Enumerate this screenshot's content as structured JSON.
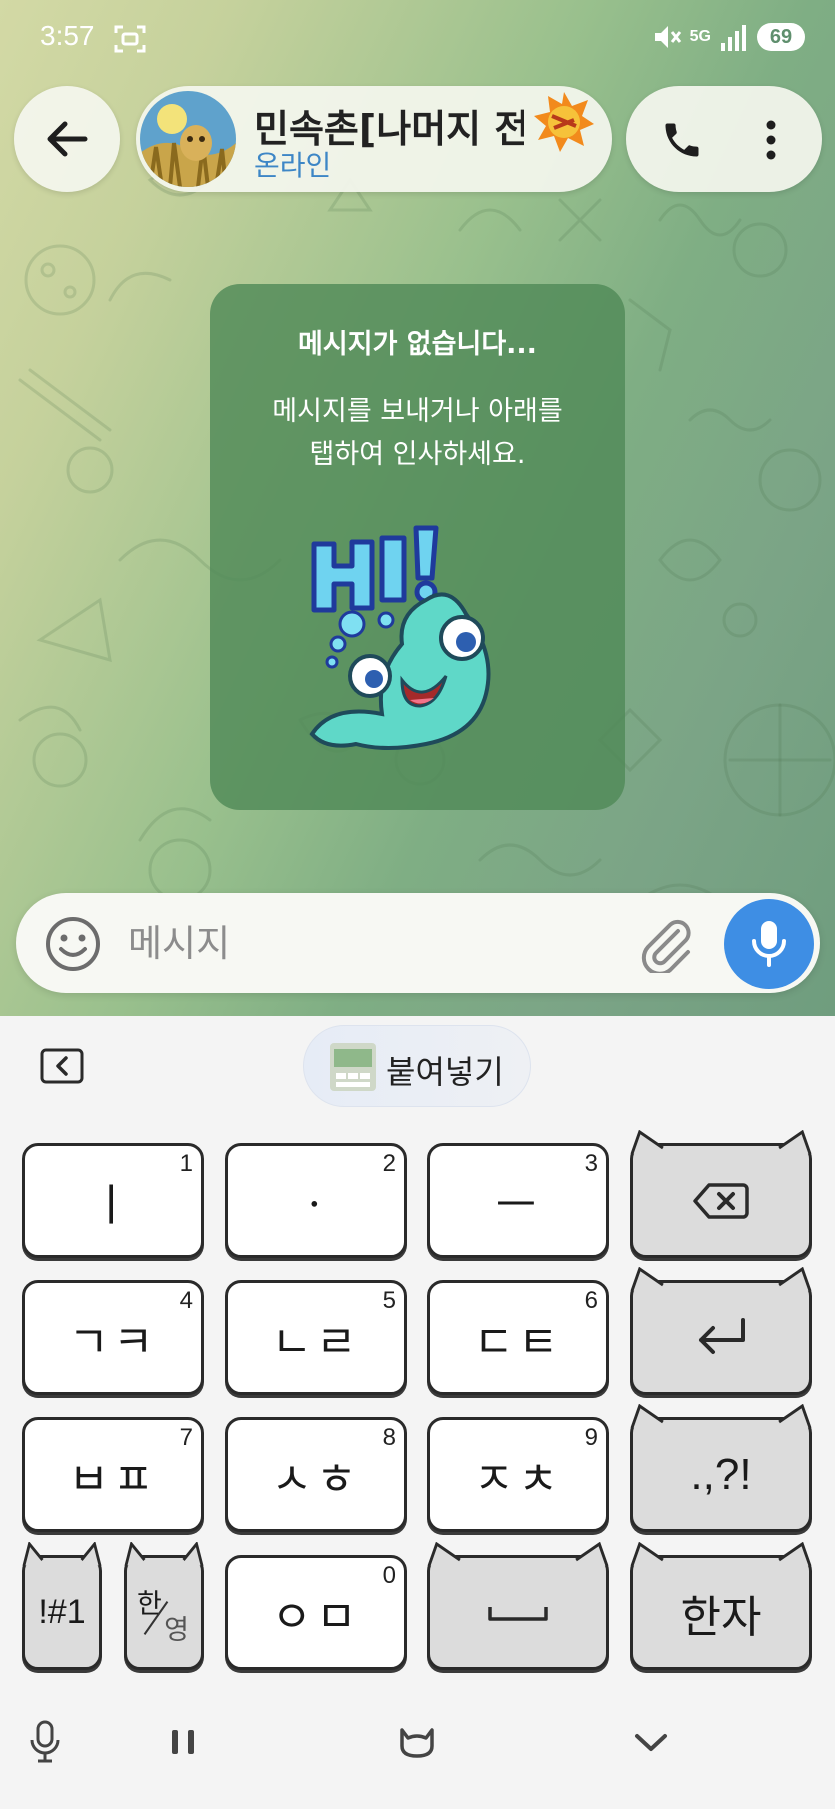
{
  "status_bar": {
    "time": "3:57",
    "network": "5G",
    "battery": "69"
  },
  "header": {
    "chat_title": "민속촌[나머지 전부",
    "chat_status": "온라인"
  },
  "empty_state": {
    "title": "메시지가 없습니다...",
    "description_line1": "메시지를 보내거나 아래를",
    "description_line2": "탭하여 인사하세요."
  },
  "input": {
    "placeholder": "메시지",
    "value": ""
  },
  "keyboard": {
    "paste_label": "붙여넣기",
    "rows": [
      [
        {
          "label": "ㅣ",
          "num": "1"
        },
        {
          "label": "ㆍ",
          "num": "2"
        },
        {
          "label": "ㅡ",
          "num": "3"
        }
      ],
      [
        {
          "label": "ㄱㅋ",
          "num": "4"
        },
        {
          "label": "ㄴㄹ",
          "num": "5"
        },
        {
          "label": "ㄷㅌ",
          "num": "6"
        }
      ],
      [
        {
          "label": "ㅂㅍ",
          "num": "7"
        },
        {
          "label": "ㅅㅎ",
          "num": "8"
        },
        {
          "label": "ㅈㅊ",
          "num": "9"
        }
      ]
    ],
    "punct_label": ".,?!",
    "symbols_label": "!#1",
    "lang_top": "한",
    "lang_bottom": "영",
    "zero_key": {
      "label": "ㅇㅁ",
      "num": "0"
    },
    "hanja_label": "한자"
  },
  "colors": {
    "accent": "#3e8ee4",
    "status_online": "#3d86c6",
    "card": "#508a58"
  },
  "icons": [
    "back-arrow-icon",
    "phone-icon",
    "more-vertical-icon",
    "emoji-icon",
    "paperclip-icon",
    "microphone-icon",
    "backspace-icon",
    "enter-icon",
    "space-icon",
    "keyboard-collapse-icon",
    "voice-input-icon",
    "pause-icon",
    "cat-icon",
    "chevron-down-icon"
  ]
}
